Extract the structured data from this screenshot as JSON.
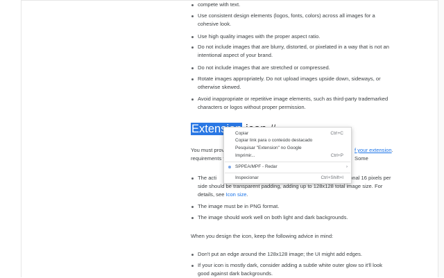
{
  "content": {
    "top_line": "compete with text.",
    "bullets_upper": [
      [
        "Use consistent design elements (logos, fonts, colors) across all images for a",
        "cohesive look."
      ],
      [
        "Use high quality images with the proper aspect ratio."
      ],
      [
        "Do not include images that are blurry, distorted, or pixelated in a way that is not an",
        "intentional aspect of your brand."
      ],
      [
        "Do not include images that are stretched or compressed."
      ],
      [
        "Rotate images appropriately. Do not upload images upside down, sideways, or",
        "otherwise skewed."
      ],
      [
        "Avoid inappropriate or repetitive image elements, such as third-party trademarked",
        "characters or logos without proper permission."
      ]
    ],
    "heading_selected": "Extension",
    "heading_rest": " icon #",
    "para1_start": "You must prov",
    "para1_link": "f your extension",
    "para1_end": ". Some",
    "para1_line2": "requirements f",
    "bullet_size_line1": "The acti",
    "bullet_size_line1_end": "onal 16 pixels per",
    "bullet_size_line2": "side should be transparent padding, adding up to 128x128 total image size. For",
    "bullet_size_line3_pre": "details, see ",
    "bullet_size_link": "Icon size",
    "bullet_size_line3_post": ".",
    "bullet_png": "The image must be in PNG format.",
    "bullet_bg": "The image should work well on both light and dark backgrounds.",
    "advice_intro": "When you design the icon, keep the following advice in mind:",
    "bullet_edge": "Don't put an edge around the 128x128 image; the UI might add edges.",
    "bullet_dark_line1": "If your icon is mostly dark, consider adding a subtle white outer glow so it'll look",
    "bullet_dark_line2": "good against dark backgrounds."
  },
  "context_menu": {
    "items": [
      {
        "label": "Copiar",
        "shortcut": "Ctrl+C"
      },
      {
        "label": "Copiar link para o conteúdo destacado",
        "shortcut": ""
      },
      {
        "label": "Pesquisar \"Extension\" no Google",
        "shortcut": ""
      },
      {
        "label": "Imprimir...",
        "shortcut": "Ctrl+P"
      }
    ],
    "extension_item": {
      "label": "SPPEA/MPF - Redar",
      "icon": "extension-icon",
      "submenu_arrow": "›"
    },
    "inspect_item": {
      "label": "Inspecionar",
      "shortcut": "Ctrl+Shift+I"
    }
  },
  "colors": {
    "selection": "#2a78e4",
    "link": "#1a73e8",
    "text": "#3c4043"
  }
}
